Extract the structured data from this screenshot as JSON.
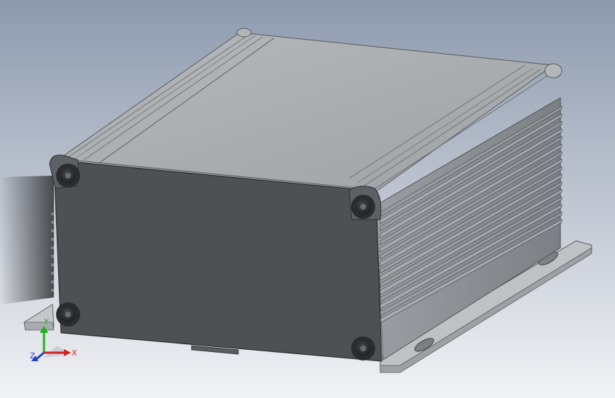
{
  "viewport": {
    "background_top": "#8d9aae",
    "background_bottom": "#f1f2f5"
  },
  "model": {
    "front_face_color": "#4e5054",
    "top_face_color": "#a9acae",
    "side_face_color": "#8c9094",
    "flange_color": "#b9bcbf",
    "screw_color": "#2b2c2e",
    "fin_count": 16,
    "front_screws": [
      "screw-top-left",
      "screw-top-right",
      "screw-bottom-left",
      "screw-bottom-right"
    ]
  },
  "triad": {
    "x_label": "X",
    "y_label": "Y",
    "z_label": "Z",
    "x_color": "#d42020",
    "y_color": "#20b020",
    "z_color": "#2040d0"
  }
}
